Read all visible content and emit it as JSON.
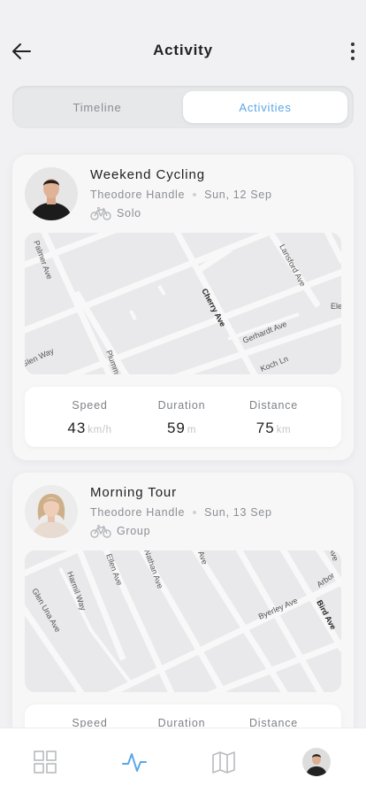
{
  "header": {
    "title": "Activity",
    "back_icon": "arrow-left-icon",
    "more_icon": "more-vertical-icon"
  },
  "tabs": [
    {
      "label": "Timeline",
      "active": false
    },
    {
      "label": "Activities",
      "active": true
    }
  ],
  "colors": {
    "accent": "#5aa6e6",
    "background": "#f1f1f3"
  },
  "activities": [
    {
      "title": "Weekend Cycling",
      "user": "Theodore Handle",
      "date": "Sun, 12 Sep",
      "type": "Solo",
      "type_icon": "bicycle-icon",
      "map_labels": [
        "Palmer Ave",
        "Lansford Ave",
        "Cherry Ave",
        "Gerhardt Ave",
        "Ele",
        "Glen Way",
        "Plummer",
        "Koch Ln"
      ],
      "stats": [
        {
          "label": "Speed",
          "value": "43",
          "unit": "km/h"
        },
        {
          "label": "Duration",
          "value": "59",
          "unit": "m"
        },
        {
          "label": "Distance",
          "value": "75",
          "unit": "km"
        }
      ]
    },
    {
      "title": "Morning Tour",
      "user": "Theodore Handle",
      "date": "Sun, 13 Sep",
      "type": "Group",
      "type_icon": "bicycle-icon",
      "map_labels": [
        "Ellen Ave",
        "Nathan Ave",
        "Ave",
        "Ave",
        "Harmil Way",
        "Glen Una Ave",
        "Byerley Ave",
        "Arbor",
        "Bird Ave"
      ],
      "stats": [
        {
          "label": "Speed",
          "value": "",
          "unit": ""
        },
        {
          "label": "Duration",
          "value": "",
          "unit": ""
        },
        {
          "label": "Distance",
          "value": "",
          "unit": ""
        }
      ]
    }
  ],
  "bottom_nav": [
    {
      "icon": "grid-icon",
      "active": false
    },
    {
      "icon": "activity-icon",
      "active": true
    },
    {
      "icon": "map-icon",
      "active": false
    },
    {
      "icon": "profile-avatar",
      "active": false
    }
  ]
}
